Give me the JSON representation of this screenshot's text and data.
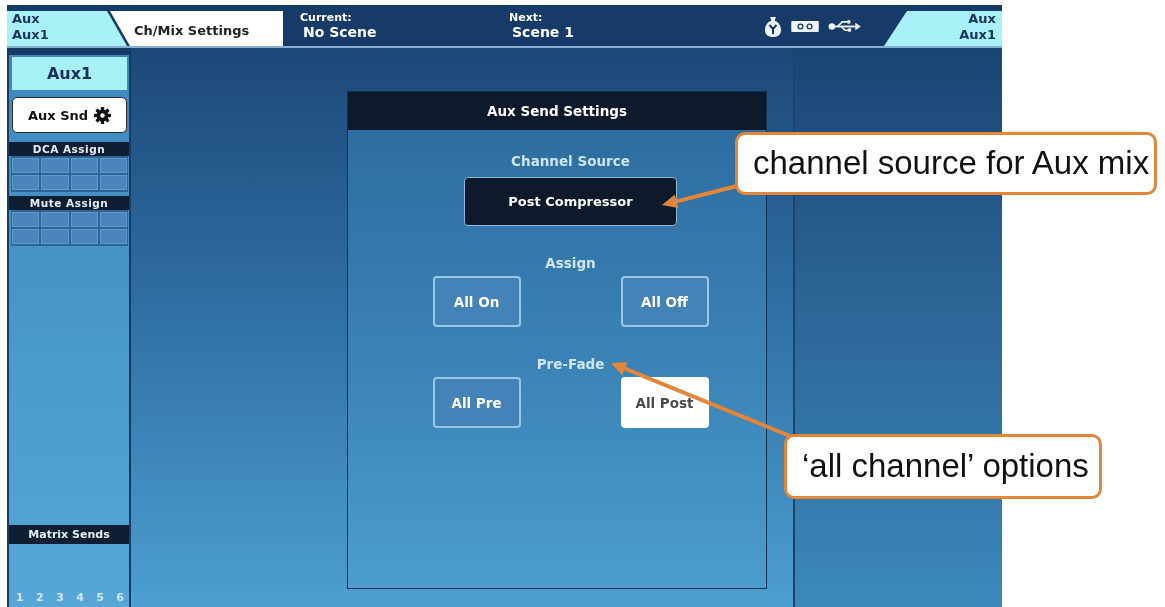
{
  "top_bar": {
    "mix_left": [
      "Aux",
      "Aux1"
    ],
    "tabs": [
      {
        "label": "Ch/Mix Settings",
        "selected": true
      }
    ],
    "scenes": [
      {
        "label": "Current:",
        "value": "No Scene"
      },
      {
        "label": "Next:",
        "value": "Scene 1"
      }
    ],
    "mix_right": [
      "Aux",
      "Aux1"
    ]
  },
  "sidebar": {
    "title": "Aux1",
    "function_button": {
      "label": "Aux Snd",
      "selected": true
    },
    "sections": [
      {
        "title": "DCA Assign",
        "slots": [
          {
            "on": false
          },
          {
            "on": false
          },
          {
            "on": false
          },
          {
            "on": false
          },
          {
            "on": false
          },
          {
            "on": false
          },
          {
            "on": false
          },
          {
            "on": false
          }
        ]
      },
      {
        "title": "Mute Assign",
        "slots": [
          {
            "on": false
          },
          {
            "on": false
          },
          {
            "on": false
          },
          {
            "on": false
          },
          {
            "on": false
          },
          {
            "on": false
          },
          {
            "on": false
          },
          {
            "on": false
          }
        ]
      }
    ],
    "matrix_sends": {
      "title": "Matrix Sends",
      "numbers": [
        "1",
        "2",
        "3",
        "4",
        "5",
        "6"
      ]
    }
  },
  "dialog": {
    "title": "Aux Send Settings",
    "groups": [
      {
        "kind": "select",
        "label": "Channel Source",
        "value": "Post Compressor"
      },
      {
        "kind": "buttons",
        "label": "Assign",
        "buttons": [
          {
            "label": "All On",
            "selected": false
          },
          {
            "label": "All Off",
            "selected": false
          }
        ]
      },
      {
        "kind": "buttons",
        "label": "Pre-Fade",
        "buttons": [
          {
            "label": "All Pre",
            "selected": false
          },
          {
            "label": "All Post",
            "selected": true
          }
        ]
      }
    ]
  },
  "callouts": [
    {
      "text": "channel source for Aux mix"
    },
    {
      "text": "‘all channel’ options"
    }
  ]
}
